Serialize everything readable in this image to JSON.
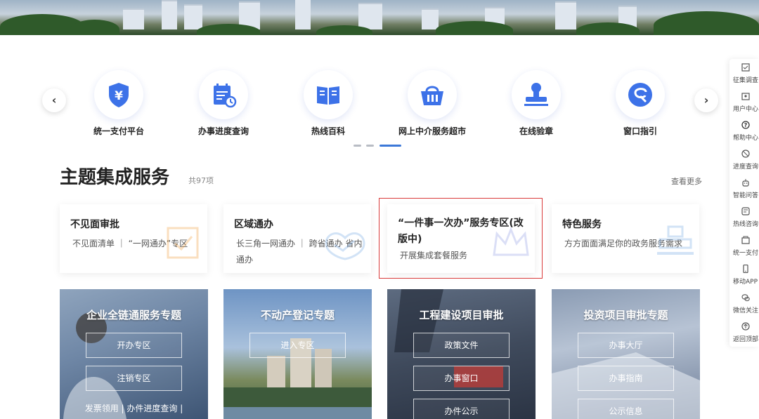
{
  "colors": {
    "accent": "#3c78d8",
    "highlight": "#d93a3a",
    "iconBlue": "#3d72e8"
  },
  "carousel": {
    "prev_label": "‹",
    "next_label": "›",
    "items": [
      {
        "label": "统一支付平台",
        "icon": "yuan-shield-icon"
      },
      {
        "label": "办事进度查询",
        "icon": "calendar-clock-icon"
      },
      {
        "label": "热线百科",
        "icon": "book-icon"
      },
      {
        "label": "网上中介服务超市",
        "icon": "basket-icon"
      },
      {
        "label": "在线验章",
        "icon": "stamp-icon"
      },
      {
        "label": "窗口指引",
        "icon": "window-guide-icon"
      }
    ],
    "page_indicator": {
      "pages": 3,
      "active": 3
    }
  },
  "section": {
    "title": "主题集成服务",
    "count": "共97项",
    "more": "查看更多"
  },
  "theme_cards": [
    {
      "title": "不见面审批",
      "sub": "不见面清单 ｜ “一网通办”专区"
    },
    {
      "title": "区域通办",
      "sub": "长三角一网通办 ｜ 跨省通办 省内通办"
    },
    {
      "title": "“一件事一次办”服务专区(改版中)",
      "sub": "开展集成套餐服务"
    },
    {
      "title": "特色服务",
      "sub": "方方面面满足你的政务服务需求"
    }
  ],
  "photo_tiles": [
    {
      "title": "企业全链通服务专题",
      "buttons": [
        "开办专区",
        "注销专区"
      ],
      "footer": "发票领用 | 办件进度查询 |"
    },
    {
      "title": "不动产登记专题",
      "buttons": [
        "进入专区"
      ],
      "footer": ""
    },
    {
      "title": "工程建设项目审批",
      "buttons": [
        "政策文件",
        "办事窗口",
        "办件公示"
      ],
      "footer": ""
    },
    {
      "title": "投资项目审批专题",
      "buttons": [
        "办事大厅",
        "办事指南",
        "公示信息"
      ],
      "footer": ""
    }
  ],
  "sidebar": [
    {
      "label": "征集调查",
      "icon": "survey-icon"
    },
    {
      "label": "用户中心",
      "icon": "user-center-icon"
    },
    {
      "label": "帮助中心",
      "icon": "help-icon"
    },
    {
      "label": "进度查询",
      "icon": "progress-icon"
    },
    {
      "label": "智能问答",
      "icon": "robot-icon"
    },
    {
      "label": "热线咨询",
      "icon": "hotline-icon"
    },
    {
      "label": "统一支付",
      "icon": "payment-icon"
    },
    {
      "label": "移动APP",
      "icon": "mobile-icon"
    },
    {
      "label": "微信关注",
      "icon": "wechat-icon"
    },
    {
      "label": "返回顶部",
      "icon": "back-to-top-icon"
    }
  ]
}
